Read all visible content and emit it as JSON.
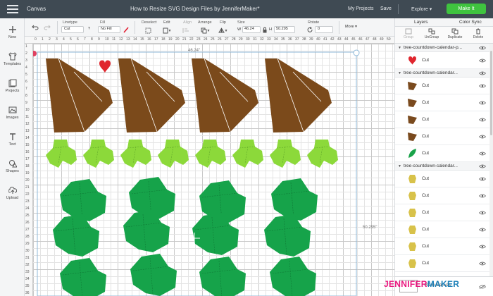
{
  "topbar": {
    "app_name": "Canvas",
    "title": "How to Resize SVG Design Files by JenniferMaker*",
    "my_projects": "My Projects",
    "save": "Save",
    "explore": "Explore",
    "make_it": "Make It"
  },
  "toolbar": {
    "linetype_label": "Linetype",
    "linetype_value": "Cut",
    "fill_label": "Fill",
    "fill_value": "No Fill",
    "deselect_label": "Deselect",
    "edit_label": "Edit",
    "align_label": "Align",
    "arrange_label": "Arrange",
    "flip_label": "Flip",
    "size_label": "Size",
    "w_label": "W",
    "w_value": "46.24",
    "h_label": "H",
    "h_value": "50.295",
    "rotate_label": "Rotate",
    "rotate_value": "0",
    "more_label": "More"
  },
  "left_nav": [
    {
      "label": "New",
      "icon": "plus-icon"
    },
    {
      "label": "Templates",
      "icon": "shirt-icon"
    },
    {
      "label": "Projects",
      "icon": "projects-icon"
    },
    {
      "label": "Images",
      "icon": "image-icon"
    },
    {
      "label": "Text",
      "icon": "text-icon"
    },
    {
      "label": "Shapes",
      "icon": "shapes-icon"
    },
    {
      "label": "Upload",
      "icon": "upload-icon"
    }
  ],
  "canvas": {
    "ruler_x": [
      "0",
      "1",
      "2",
      "3",
      "4",
      "5",
      "6",
      "7",
      "8",
      "9",
      "10",
      "11",
      "12",
      "13",
      "14",
      "15",
      "16",
      "17",
      "18",
      "19",
      "20",
      "21",
      "22",
      "23",
      "24",
      "25",
      "26",
      "27",
      "28",
      "29",
      "30",
      "31",
      "32",
      "33",
      "34",
      "35",
      "36",
      "37",
      "38",
      "39",
      "40",
      "41",
      "42",
      "43",
      "44",
      "45",
      "46",
      "47",
      "48",
      "49",
      "50"
    ],
    "ruler_y": [
      "1",
      "2",
      "3",
      "4",
      "5",
      "6",
      "7",
      "8",
      "9",
      "10",
      "11",
      "12",
      "13",
      "14",
      "15",
      "16",
      "17",
      "18",
      "19",
      "20",
      "21",
      "22",
      "23",
      "24",
      "25",
      "26",
      "27",
      "28",
      "29",
      "30",
      "31",
      "32",
      "33",
      "34",
      "35",
      "36"
    ],
    "width_label": "46.24\"",
    "height_label": "50.295\""
  },
  "panel": {
    "tab_layers": "Layers",
    "tab_color_sync": "Color Sync",
    "actions": [
      {
        "label": "Group",
        "icon": "group-icon",
        "disabled": true
      },
      {
        "label": "UnGroup",
        "icon": "ungroup-icon",
        "disabled": false
      },
      {
        "label": "Duplicate",
        "icon": "duplicate-icon",
        "disabled": false
      },
      {
        "label": "Delete",
        "icon": "delete-icon",
        "disabled": false
      }
    ],
    "rows": [
      {
        "kind": "group",
        "name": "tree-countdown-calendar-p..."
      },
      {
        "kind": "item",
        "label": "Cut",
        "color": "#e0262e",
        "shape": "heart"
      },
      {
        "kind": "group",
        "name": "tree-countdown-calendar..."
      },
      {
        "kind": "item",
        "label": "Cut",
        "color": "#7a4a1e",
        "shape": "tri"
      },
      {
        "kind": "item",
        "label": "Cut",
        "color": "#7a4a1e",
        "shape": "tri"
      },
      {
        "kind": "item",
        "label": "Cut",
        "color": "#7a4a1e",
        "shape": "tri"
      },
      {
        "kind": "item",
        "label": "Cut",
        "color": "#7a4a1e",
        "shape": "tri"
      },
      {
        "kind": "item",
        "label": "Cut",
        "color": "#1aa34a",
        "shape": "leaf"
      },
      {
        "kind": "group",
        "name": "tree-countdown-calendar..."
      },
      {
        "kind": "item",
        "label": "Cut",
        "color": "#d8c24a",
        "shape": "blob"
      },
      {
        "kind": "item",
        "label": "Cut",
        "color": "#d8c24a",
        "shape": "blob"
      },
      {
        "kind": "item",
        "label": "Cut",
        "color": "#d8c24a",
        "shape": "blob"
      },
      {
        "kind": "item",
        "label": "Cut",
        "color": "#d8c24a",
        "shape": "blob"
      },
      {
        "kind": "item",
        "label": "Cut",
        "color": "#d8c24a",
        "shape": "blob"
      },
      {
        "kind": "item",
        "label": "Cut",
        "color": "#d8c24a",
        "shape": "blob"
      }
    ],
    "blank_canvas": "Blank Canvas"
  },
  "logo": {
    "part1": "JENNIFER",
    "part2": "MAKER"
  },
  "colors": {
    "brown": "#7b4a1b",
    "lime": "#8cd93a",
    "green": "#16a34a",
    "accent_green": "#3fc33f"
  }
}
